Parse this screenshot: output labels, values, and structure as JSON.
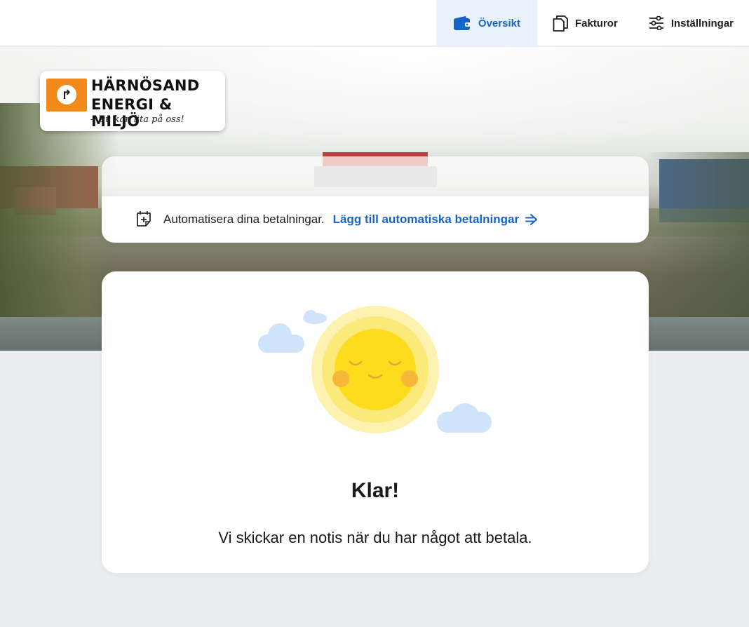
{
  "nav": {
    "items": [
      {
        "label": "Översikt",
        "icon": "wallet-icon",
        "active": true
      },
      {
        "label": "Fakturor",
        "icon": "documents-icon",
        "active": false
      },
      {
        "label": "Inställningar",
        "icon": "sliders-icon",
        "active": false
      }
    ]
  },
  "logo": {
    "line1": "HÄRNÖSAND",
    "line2": "ENERGI & MILJÖ",
    "tagline": "– Du kan lita på oss!"
  },
  "autopay": {
    "text": "Automatisera dina betalningar.",
    "link": "Lägg till automatiska betalningar",
    "icon": "calendar-plus-icon"
  },
  "status": {
    "title": "Klar!",
    "message": "Vi skickar en notis när du har något att betala.",
    "illustration": "smiling-sun-icon"
  },
  "colors": {
    "accent": "#1565c8",
    "active_nav_bg": "#e8f1fc",
    "logo_orange": "#f08a1c",
    "sun_yellow": "#fcdc1c",
    "cloud_blue": "#cfe3fb"
  }
}
